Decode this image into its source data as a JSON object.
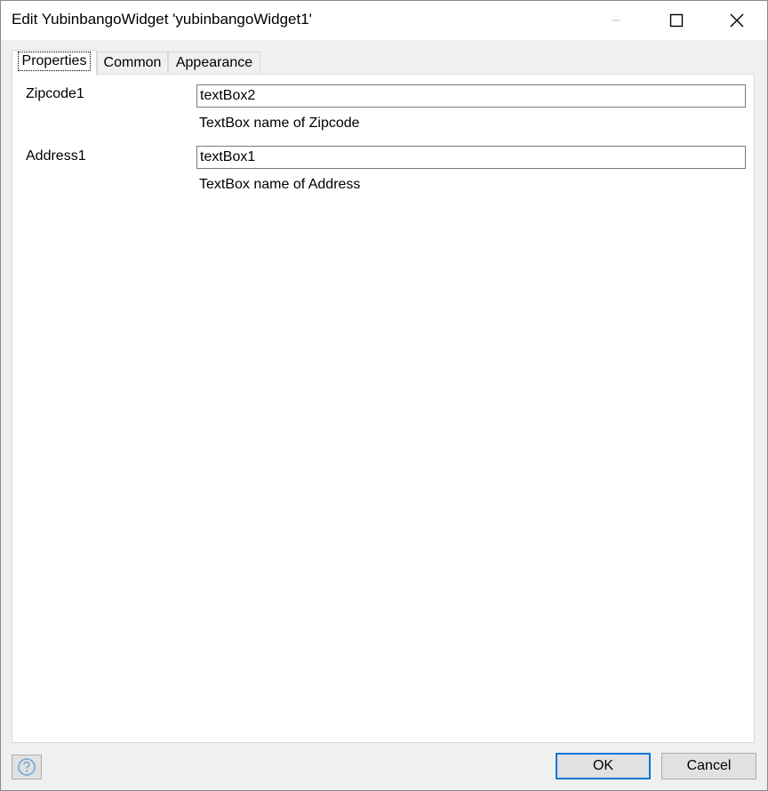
{
  "window": {
    "title": "Edit YubinbangoWidget 'yubinbangoWidget1'"
  },
  "titlebar_buttons": {
    "minimize_icon": "minimize-icon",
    "maximize_icon": "maximize-icon",
    "close_icon": "close-icon"
  },
  "tabs": [
    {
      "label": "Properties",
      "active": true
    },
    {
      "label": "Common",
      "active": false
    },
    {
      "label": "Appearance",
      "active": false
    }
  ],
  "properties": [
    {
      "label": "Zipcode1",
      "value": "textBox2",
      "description": "TextBox name of Zipcode"
    },
    {
      "label": "Address1",
      "value": "textBox1",
      "description": "TextBox name of Address"
    }
  ],
  "footer": {
    "help_icon": "help-icon",
    "ok_label": "OK",
    "cancel_label": "Cancel"
  },
  "colors": {
    "dialog_bg": "#f0f0f0",
    "panel_bg": "#ffffff",
    "default_button_border": "#0078d7",
    "help_icon_color": "#6fa8dc"
  }
}
